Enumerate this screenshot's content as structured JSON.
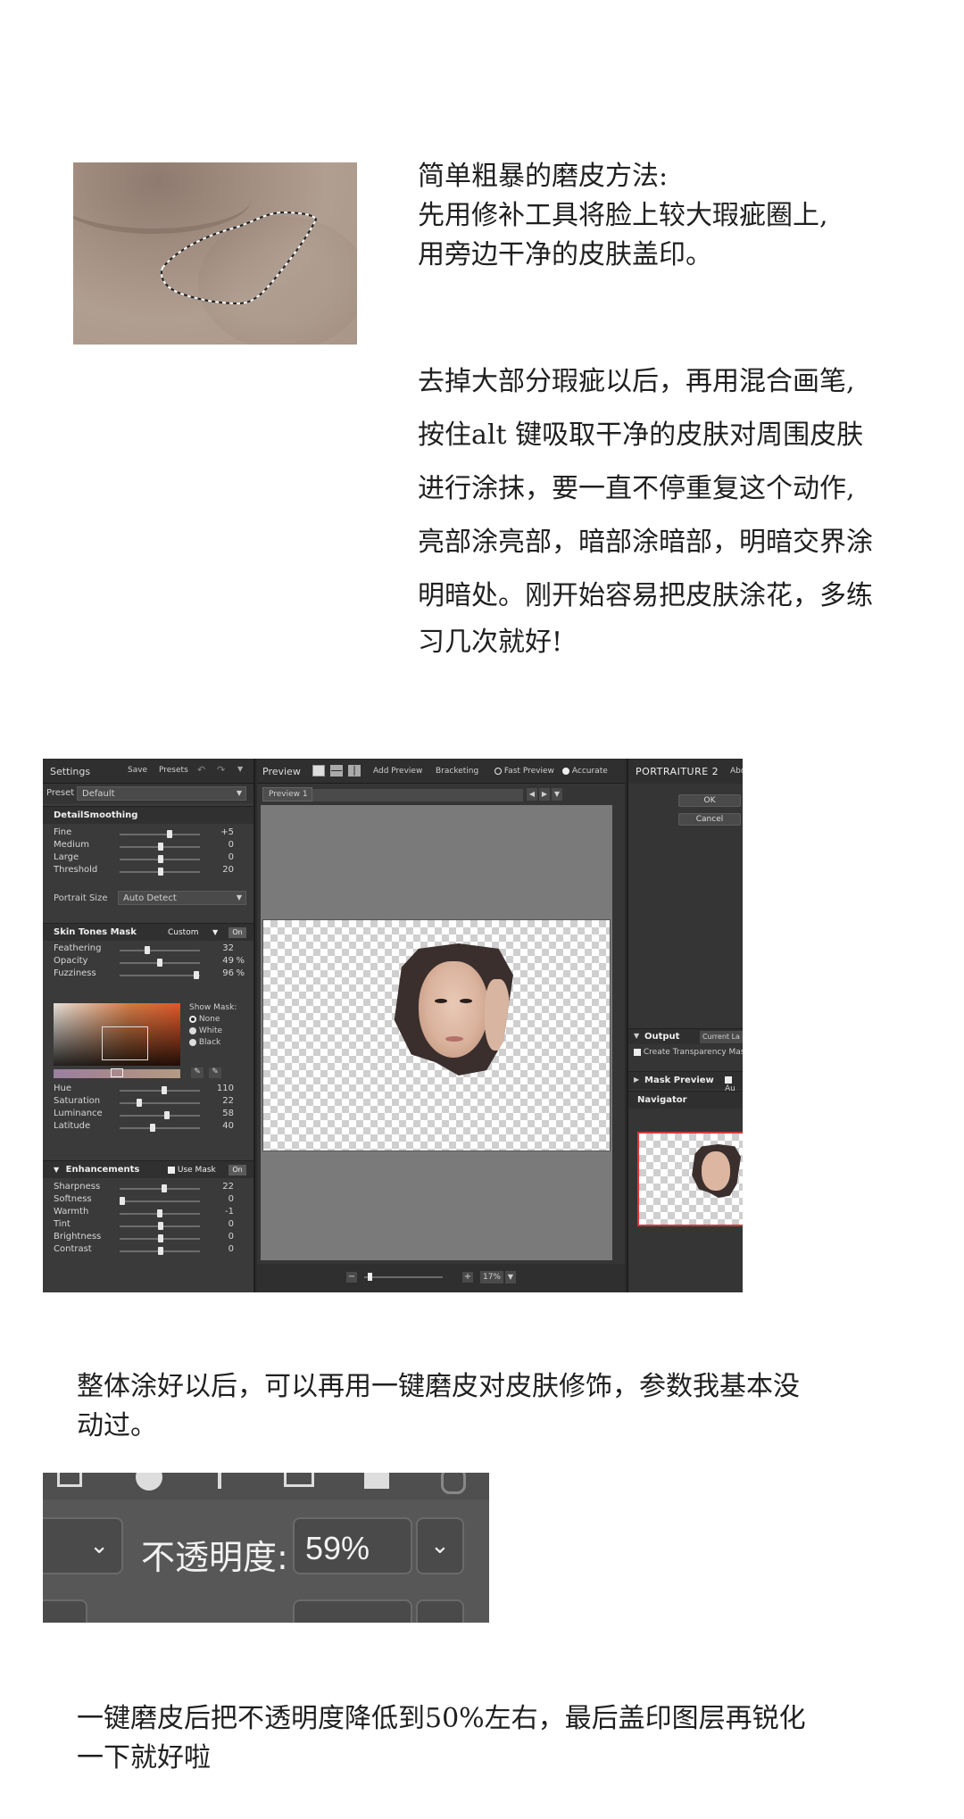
{
  "intro": {
    "lines": [
      "简单粗暴的磨皮方法:",
      "先用修补工具将脸上较大瑕疵圈上,",
      "用旁边干净的皮肤盖印。"
    ]
  },
  "step2": {
    "lines": [
      "去掉大部分瑕疵以后，再用混合画笔,",
      "按住alt 键吸取干净的皮肤对周围皮肤",
      "进行涂抹，要一直不停重复这个动作,",
      "亮部涂亮部，暗部涂暗部，明暗交界涂",
      "明暗处。刚开始容易把皮肤涂花，多练",
      "习几次就好!"
    ]
  },
  "portraiture": {
    "settings_title": "Settings",
    "save": "Save",
    "presets": "Presets",
    "preset_label": "Preset",
    "preset_value": "Default",
    "detail_section": "DetailSmoothing",
    "detail_rows": [
      {
        "label": "Fine",
        "value": "+5",
        "level": 0.62
      },
      {
        "label": "Medium",
        "value": "0",
        "level": 0.5
      },
      {
        "label": "Large",
        "value": "0",
        "level": 0.5
      },
      {
        "label": "Threshold",
        "value": "20",
        "level": 0.5
      }
    ],
    "portrait_size_label": "Portrait Size",
    "portrait_size_value": "Auto Detect",
    "skin_section": "Skin Tones Mask",
    "skin_mode": "Custom",
    "skin_toggle": "On",
    "skin_rows": [
      {
        "label": "Feathering",
        "value": "32",
        "unit": "",
        "level": 0.32
      },
      {
        "label": "Opacity",
        "value": "49",
        "unit": "%",
        "level": 0.49
      },
      {
        "label": "Fuzziness",
        "value": "96",
        "unit": "%",
        "level": 0.96
      }
    ],
    "show_mask_label": "Show Mask:",
    "show_mask_options": [
      "None",
      "White",
      "Black"
    ],
    "hsl_rows": [
      {
        "label": "Hue",
        "value": "110",
        "level": 0.55
      },
      {
        "label": "Saturation",
        "value": "22",
        "level": 0.22
      },
      {
        "label": "Luminance",
        "value": "58",
        "level": 0.58
      },
      {
        "label": "Latitude",
        "value": "40",
        "level": 0.4
      }
    ],
    "enh_section": "Enhancements",
    "use_mask": "Use Mask",
    "enh_toggle": "On",
    "enh_rows": [
      {
        "label": "Sharpness",
        "value": "22",
        "level": 0.55
      },
      {
        "label": "Softness",
        "value": "0",
        "level": 0.0
      },
      {
        "label": "Warmth",
        "value": "-1",
        "level": 0.49
      },
      {
        "label": "Tint",
        "value": "0",
        "level": 0.5
      },
      {
        "label": "Brightness",
        "value": "0",
        "level": 0.5
      },
      {
        "label": "Contrast",
        "value": "0",
        "level": 0.5
      }
    ],
    "preview_title": "Preview",
    "add_preview": "Add Preview",
    "bracketing": "Bracketing",
    "fast_preview": "Fast Preview",
    "accurate": "Accurate",
    "preview_tab": "Preview 1",
    "zoom": "17%",
    "brand": "PORTRAITURE 2",
    "about": "Abo",
    "ok": "OK",
    "cancel": "Cancel",
    "output": "Output",
    "output_value": "Current La",
    "transparency_mask": "Create Transparency Mask",
    "mask_preview": "Mask Preview",
    "mask_preview_right": "Au",
    "navigator": "Navigator"
  },
  "step3": {
    "lines": [
      "整体涂好以后，可以再用一键磨皮对皮肤修饰，参数我基本没",
      "动过。"
    ]
  },
  "opacity_bar": {
    "label": "不透明度:",
    "value": "59%"
  },
  "step4": {
    "lines": [
      "一键磨皮后把不透明度降低到50%左右，最后盖印图层再锐化",
      "一下就好啦"
    ]
  },
  "colors": {
    "accent_red": "#d33a3a"
  }
}
